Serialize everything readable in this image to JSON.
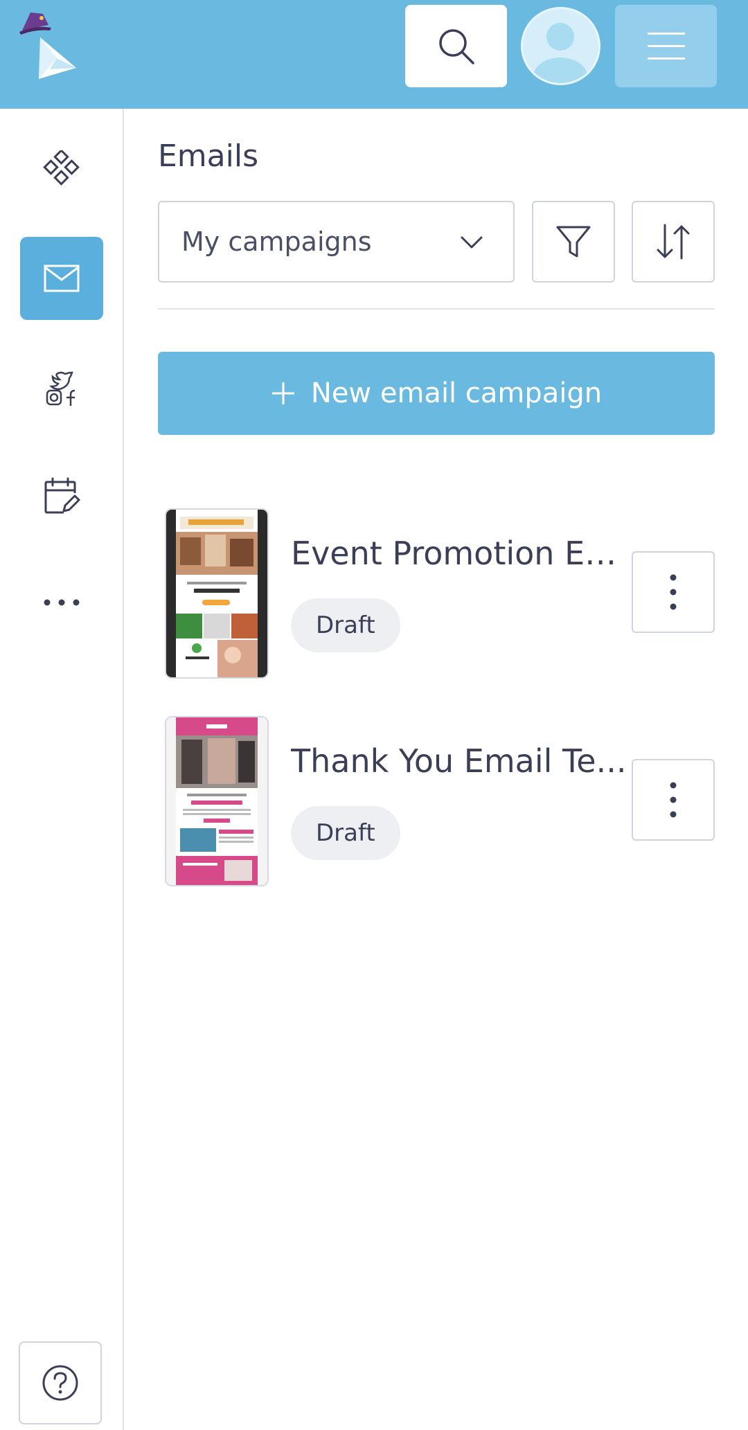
{
  "header": {
    "logo_icon": "origami-bird-with-hat-logo",
    "search_icon": "search-icon",
    "avatar_icon": "user-avatar-icon",
    "menu_icon": "hamburger-menu-icon"
  },
  "sidebar": {
    "items": [
      {
        "name": "dashboard",
        "icon": "grid-diamonds-icon",
        "active": false
      },
      {
        "name": "emails",
        "icon": "envelope-icon",
        "active": true
      },
      {
        "name": "social",
        "icon": "social-media-icon",
        "active": false
      },
      {
        "name": "calendar",
        "icon": "calendar-edit-icon",
        "active": false
      },
      {
        "name": "more",
        "icon": "more-horizontal-icon",
        "active": false
      }
    ],
    "help_icon": "help-icon"
  },
  "main": {
    "title": "Emails",
    "filter_select": {
      "value": "My campaigns"
    },
    "new_button_label": "New email campaign",
    "campaigns": [
      {
        "title": "Event Promotion Em...",
        "status": "Draft",
        "thumbnail": "community-event-template"
      },
      {
        "title": "Thank You Email Te...",
        "status": "Draft",
        "thumbnail": "fitness-thank-you-template"
      }
    ]
  },
  "colors": {
    "topbar": "#69b9e1",
    "accent": "#5aafdc",
    "text": "#3a3f57"
  }
}
